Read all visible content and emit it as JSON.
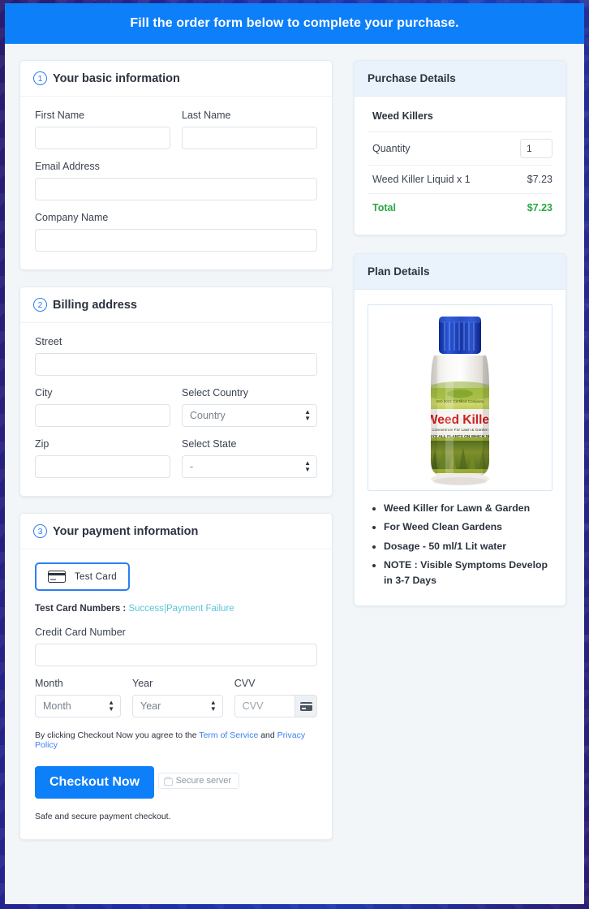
{
  "banner": {
    "text": "Fill the order form below to complete your purchase."
  },
  "colors": {
    "banner_blue": "#0d7ff9",
    "accent_blue": "#2b7ff0",
    "link_teal": "#5cc4d8",
    "link_blue": "#3b82f0",
    "total_green": "#2aa745",
    "panel_head": "#eaf3fc",
    "page_bg": "#f2f6f9"
  },
  "basic_info": {
    "step": "1",
    "title": "Your basic information",
    "fields": [
      {
        "label": "First Name",
        "value": "",
        "placeholder": ""
      },
      {
        "label": "Last Name",
        "value": "",
        "placeholder": ""
      },
      {
        "label": "Email Address",
        "value": "",
        "placeholder": ""
      },
      {
        "label": "Company Name",
        "value": "",
        "placeholder": ""
      }
    ]
  },
  "billing": {
    "step": "2",
    "title": "Billing address",
    "street_label": "Street",
    "street_value": "",
    "city_label": "City",
    "city_value": "",
    "country_label": "Select Country",
    "country_value": "Country",
    "zip_label": "Zip",
    "zip_value": "",
    "state_label": "Select State",
    "state_value": "-"
  },
  "payment": {
    "step": "3",
    "title": "Your payment information",
    "test_card_button": "Test  Card",
    "test_numbers_label": "Test Card Numbers :",
    "test_success_link": "Success",
    "test_failure_link": "Payment Failure",
    "separator": "|",
    "cc_label": "Credit Card Number",
    "cc_value": "",
    "month_label": "Month",
    "month_value": "Month",
    "year_label": "Year",
    "year_value": "Year",
    "cvv_label": "CVV",
    "cvv_placeholder": "CVV",
    "cvv_value": "",
    "terms_prefix": "By clicking Checkout Now you agree to the",
    "terms_link": "Term of Service",
    "terms_and": "and",
    "privacy_link": "Privacy Policy",
    "checkout_button": "Checkout Now",
    "secure_badge": "Secure server",
    "safe_note": "Safe and secure payment checkout."
  },
  "purchase_details": {
    "title": "Purchase Details",
    "product_name": "Weed Killers",
    "quantity_label": "Quantity",
    "quantity_value": "1",
    "line_item_label": "Weed Killer Liquid x 1",
    "line_item_amount": "$7.23",
    "total_label": "Total",
    "total_amount": "$7.23"
  },
  "plan_details": {
    "title": "Plan Details",
    "product_image_alt": "Weed Killer bottle",
    "product_label_brand": "Weed Killer",
    "product_label_sub": "Concentrate For Lawn & Garden",
    "product_label_claim": "DESTROYS ALL PLANTS ON WHICH SPRAYED",
    "product_label_iso": "ISO 9001 Certified Company",
    "bullets": [
      "Weed Killer for Lawn & Garden",
      "For Weed Clean Gardens",
      "Dosage - 50 ml/1 Lit water",
      "NOTE : Visible Symptoms Develop in 3-7 Days"
    ]
  }
}
